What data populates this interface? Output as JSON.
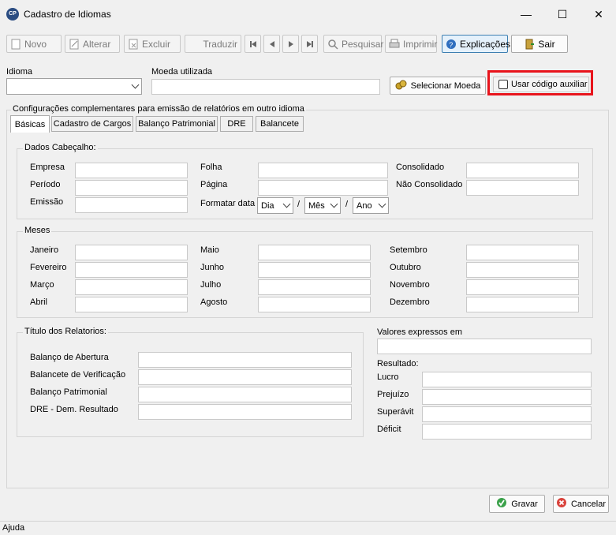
{
  "window": {
    "title": "Cadastro de Idiomas",
    "app_icon_text": "CP",
    "min": "—",
    "max": "☐",
    "close": "✕"
  },
  "toolbar": {
    "novo": "Novo",
    "alterar": "Alterar",
    "excluir": "Excluir",
    "traduzir": "Traduzir",
    "pesquisar": "Pesquisar",
    "imprimir": "Imprimir",
    "explicacoes": "Explicações",
    "sair": "Sair"
  },
  "form": {
    "idioma_label": "Idioma",
    "moeda_label": "Moeda utilizada",
    "selecionar_moeda": "Selecionar Moeda",
    "usar_codigo": "Usar código auxiliar"
  },
  "config_label": "Configurações complementares para emissão de relatórios em outro idioma",
  "tabs": [
    "Básicas",
    "Cadastro de Cargos",
    "Balanço Patrimonial",
    "DRE",
    "Balancete"
  ],
  "cabecalho": {
    "title": "Dados Cabeçalho:",
    "empresa": "Empresa",
    "periodo": "Período",
    "emissao": "Emissão",
    "folha": "Folha",
    "pagina": "Página",
    "formatar_data": "Formatar data",
    "consolidado": "Consolidado",
    "nao_consolidado": "Não Consolidado",
    "dia": "Dia",
    "mes": "Mês",
    "ano": "Ano",
    "sep": "/"
  },
  "meses": {
    "title": "Meses",
    "list": [
      "Janeiro",
      "Fevereiro",
      "Março",
      "Abril",
      "Maio",
      "Junho",
      "Julho",
      "Agosto",
      "Setembro",
      "Outubro",
      "Novembro",
      "Dezembro"
    ]
  },
  "titulos": {
    "title": "Título dos Relatorios:",
    "list": [
      "Balanço de Abertura",
      "Balancete de Verificação",
      "Balanço Patrimonial",
      "DRE - Dem. Resultado"
    ]
  },
  "valores": {
    "title": "Valores expressos em",
    "resultado": "Resultado:",
    "lucro": "Lucro",
    "prejuizo": "Prejuízo",
    "superavit": "Superávit",
    "deficit": "Déficit"
  },
  "buttons": {
    "gravar": "Gravar",
    "cancelar": "Cancelar"
  },
  "status": "Ajuda",
  "colors": {
    "highlight": "#e8141c",
    "accent": "#3c7fb1"
  }
}
